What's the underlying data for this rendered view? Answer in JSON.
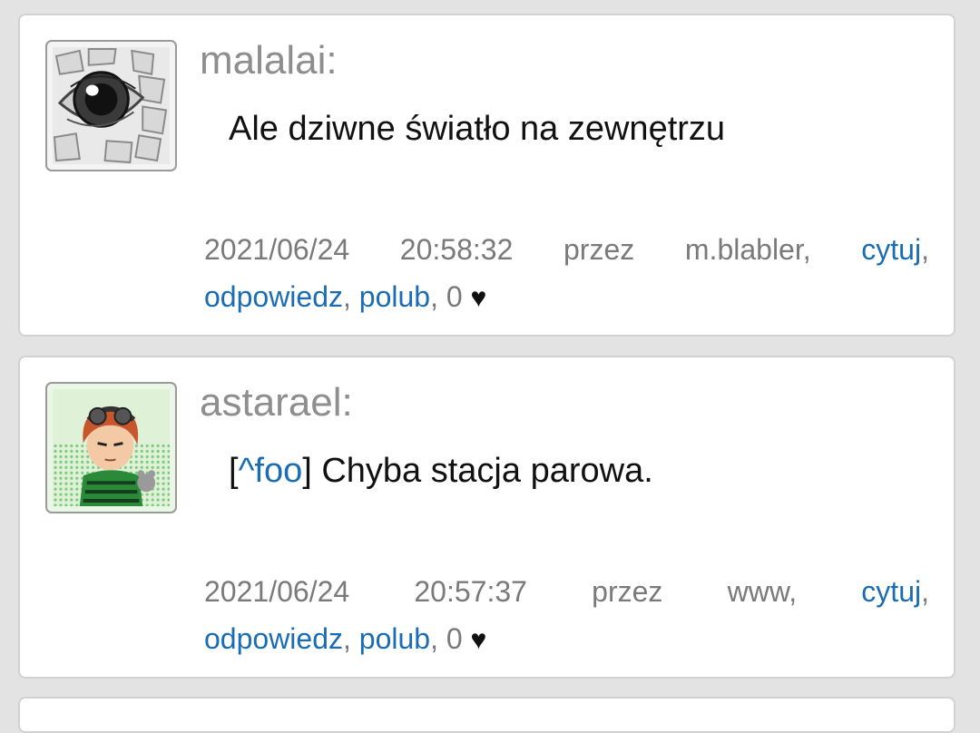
{
  "posts": [
    {
      "author": "malalai:",
      "avatar_icon": "eye-sketch-avatar",
      "message": "Ale dziwne światło na zewnętrzu",
      "date": "2021/06/24",
      "time": "20:58:32",
      "by_label": "przez",
      "via": "m.blabler,",
      "quote_label": "cytuj",
      "reply_label": "odpowiedz",
      "like_label": "polub",
      "like_count": "0",
      "heart": "♥"
    },
    {
      "author": "astarael:",
      "avatar_icon": "anime-character-avatar",
      "quote_ref": "^foo",
      "message": "Chyba stacja parowa.",
      "date": "2021/06/24",
      "time": "20:57:37",
      "by_label": "przez",
      "via": "www,",
      "quote_label": "cytuj",
      "reply_label": "odpowiedz",
      "like_label": "polub",
      "like_count": "0",
      "heart": "♥"
    }
  ]
}
